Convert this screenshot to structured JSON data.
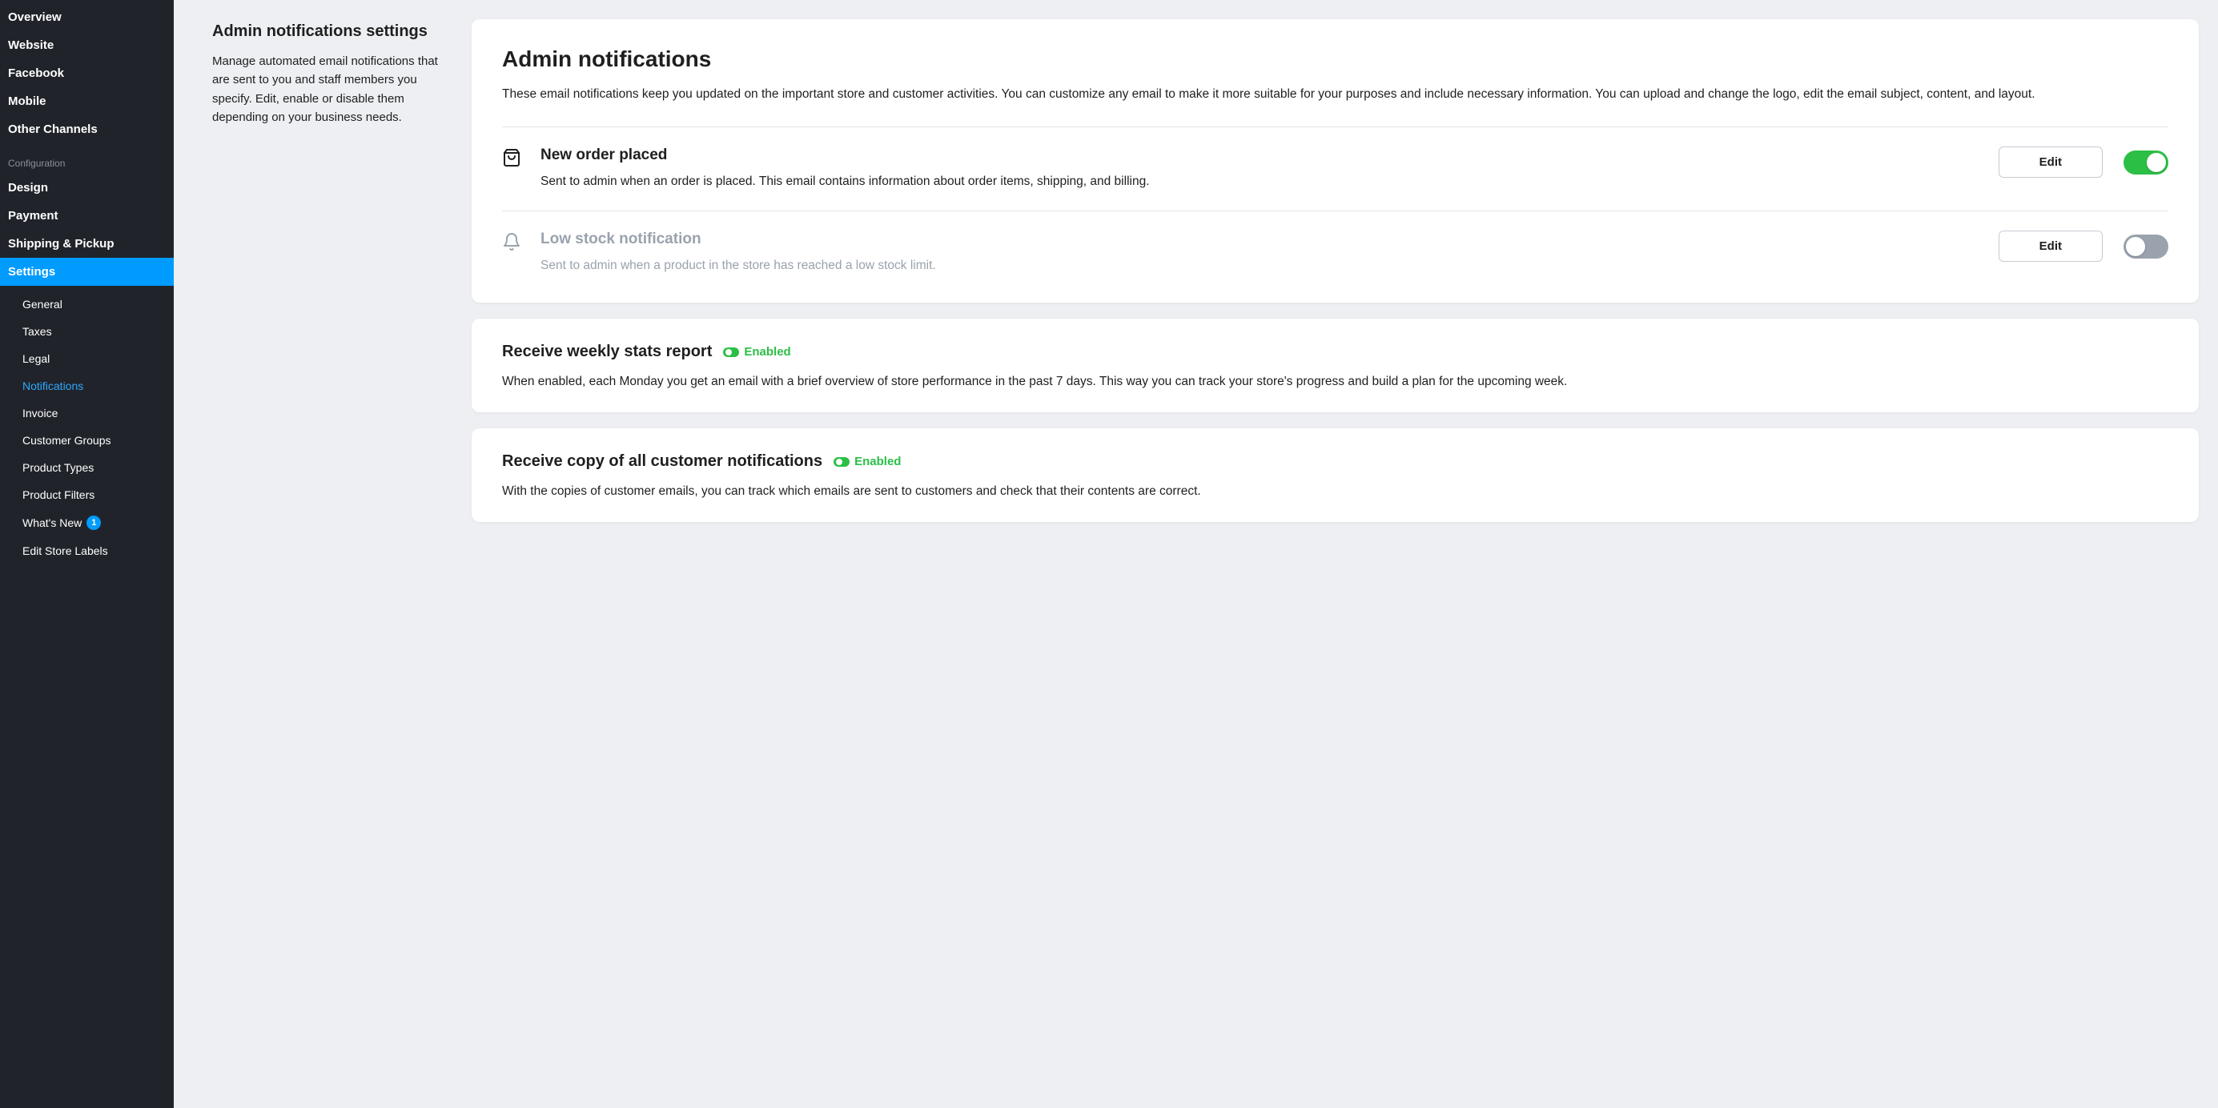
{
  "sidebar": {
    "channels": [
      {
        "label": "Overview"
      },
      {
        "label": "Website"
      },
      {
        "label": "Facebook"
      },
      {
        "label": "Mobile"
      },
      {
        "label": "Other Channels"
      }
    ],
    "section_label": "Configuration",
    "config": [
      {
        "label": "Design"
      },
      {
        "label": "Payment"
      },
      {
        "label": "Shipping & Pickup"
      },
      {
        "label": "Settings",
        "active": true
      }
    ],
    "settings_sub": [
      {
        "label": "General"
      },
      {
        "label": "Taxes"
      },
      {
        "label": "Legal"
      },
      {
        "label": "Notifications",
        "selected": true
      },
      {
        "label": "Invoice"
      },
      {
        "label": "Customer Groups"
      },
      {
        "label": "Product Types"
      },
      {
        "label": "Product Filters"
      },
      {
        "label": "What's New",
        "badge": "1"
      },
      {
        "label": "Edit Store Labels"
      }
    ]
  },
  "intro": {
    "title": "Admin notifications settings",
    "text": "Manage automated email notifications that are sent to you and staff members you specify. Edit, enable or disable them depending on your business needs."
  },
  "main_card": {
    "title": "Admin notifications",
    "desc": "These email notifications keep you updated on the important store and customer activities. You can customize any email to make it more suitable for your purposes and include necessary information. You can upload and change the logo, edit the email subject, content, and layout.",
    "rows": [
      {
        "icon": "shopping-bag-icon",
        "title": "New order placed",
        "desc": "Sent to admin when an order is placed. This email contains information about order items, shipping, and billing.",
        "edit_label": "Edit",
        "enabled": true
      },
      {
        "icon": "bell-icon",
        "title": "Low stock notification",
        "desc": "Sent to admin when a product in the store has reached a low stock limit.",
        "edit_label": "Edit",
        "enabled": false
      }
    ]
  },
  "stats_card": {
    "title": "Receive weekly stats report",
    "status": "Enabled",
    "desc": "When enabled, each Monday you get an email with a brief overview of store performance in the past 7 days. This way you can track your store's progress and build a plan for the upcoming week."
  },
  "copy_card": {
    "title": "Receive copy of all customer notifications",
    "status": "Enabled",
    "desc": "With the copies of customer emails, you can track which emails are sent to customers and check that their contents are correct."
  }
}
